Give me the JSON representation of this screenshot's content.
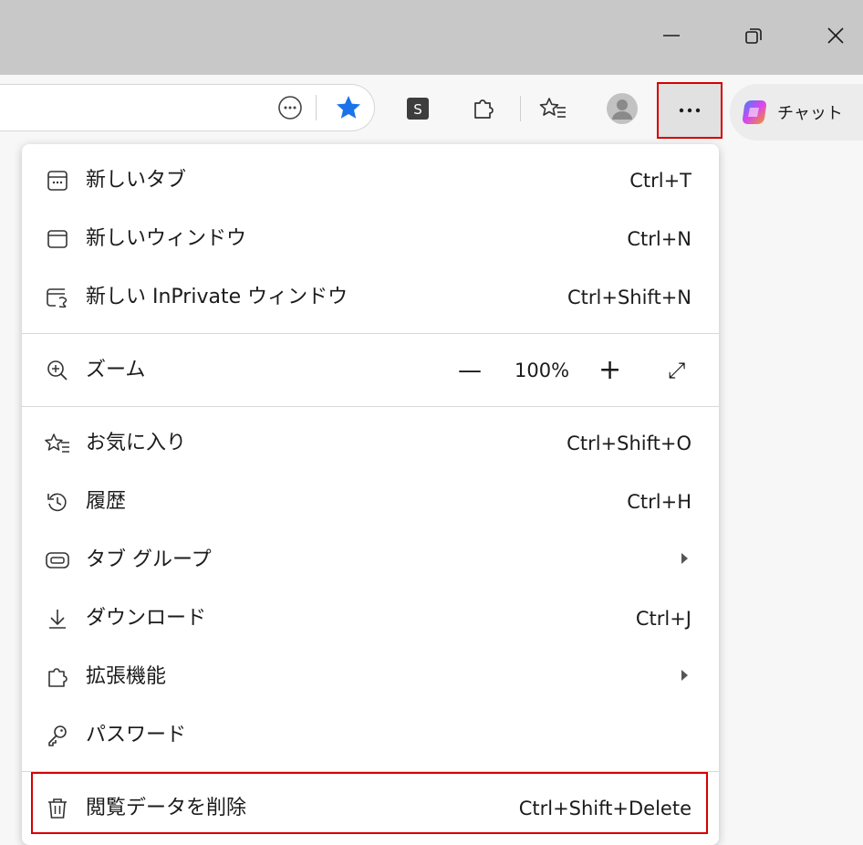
{
  "chat_label": "チャット",
  "menu": {
    "new_tab": {
      "label": "新しいタブ",
      "shortcut": "Ctrl+T"
    },
    "new_window": {
      "label": "新しいウィンドウ",
      "shortcut": "Ctrl+N"
    },
    "new_inprivate": {
      "label": "新しい InPrivate ウィンドウ",
      "shortcut": "Ctrl+Shift+N"
    },
    "zoom": {
      "label": "ズーム",
      "minus": "—",
      "value": "100%",
      "plus": "+",
      "fullscreen": "⤢"
    },
    "favorites": {
      "label": "お気に入り",
      "shortcut": "Ctrl+Shift+O"
    },
    "history": {
      "label": "履歴",
      "shortcut": "Ctrl+H"
    },
    "tab_groups": {
      "label": "タブ グループ"
    },
    "downloads": {
      "label": "ダウンロード",
      "shortcut": "Ctrl+J"
    },
    "extensions": {
      "label": "拡張機能"
    },
    "passwords": {
      "label": "パスワード"
    },
    "clear_data": {
      "label": "閲覧データを削除",
      "shortcut": "Ctrl+Shift+Delete"
    }
  },
  "icons": {
    "minimize": "minimize-icon",
    "restore": "restore-icon",
    "close": "close-icon",
    "more_tools": "more-tools-icon",
    "favorite_star": "star-filled-icon",
    "s_extension": "s-extension-icon",
    "extensions": "puzzle-icon",
    "favorites": "favorites-icon",
    "profile": "profile-icon",
    "more": "more-dots-icon",
    "copilot": "copilot-icon"
  },
  "colors": {
    "highlight_border": "#d60000",
    "star_blue": "#1a73e8",
    "titlebar": "#c8c8c8"
  }
}
